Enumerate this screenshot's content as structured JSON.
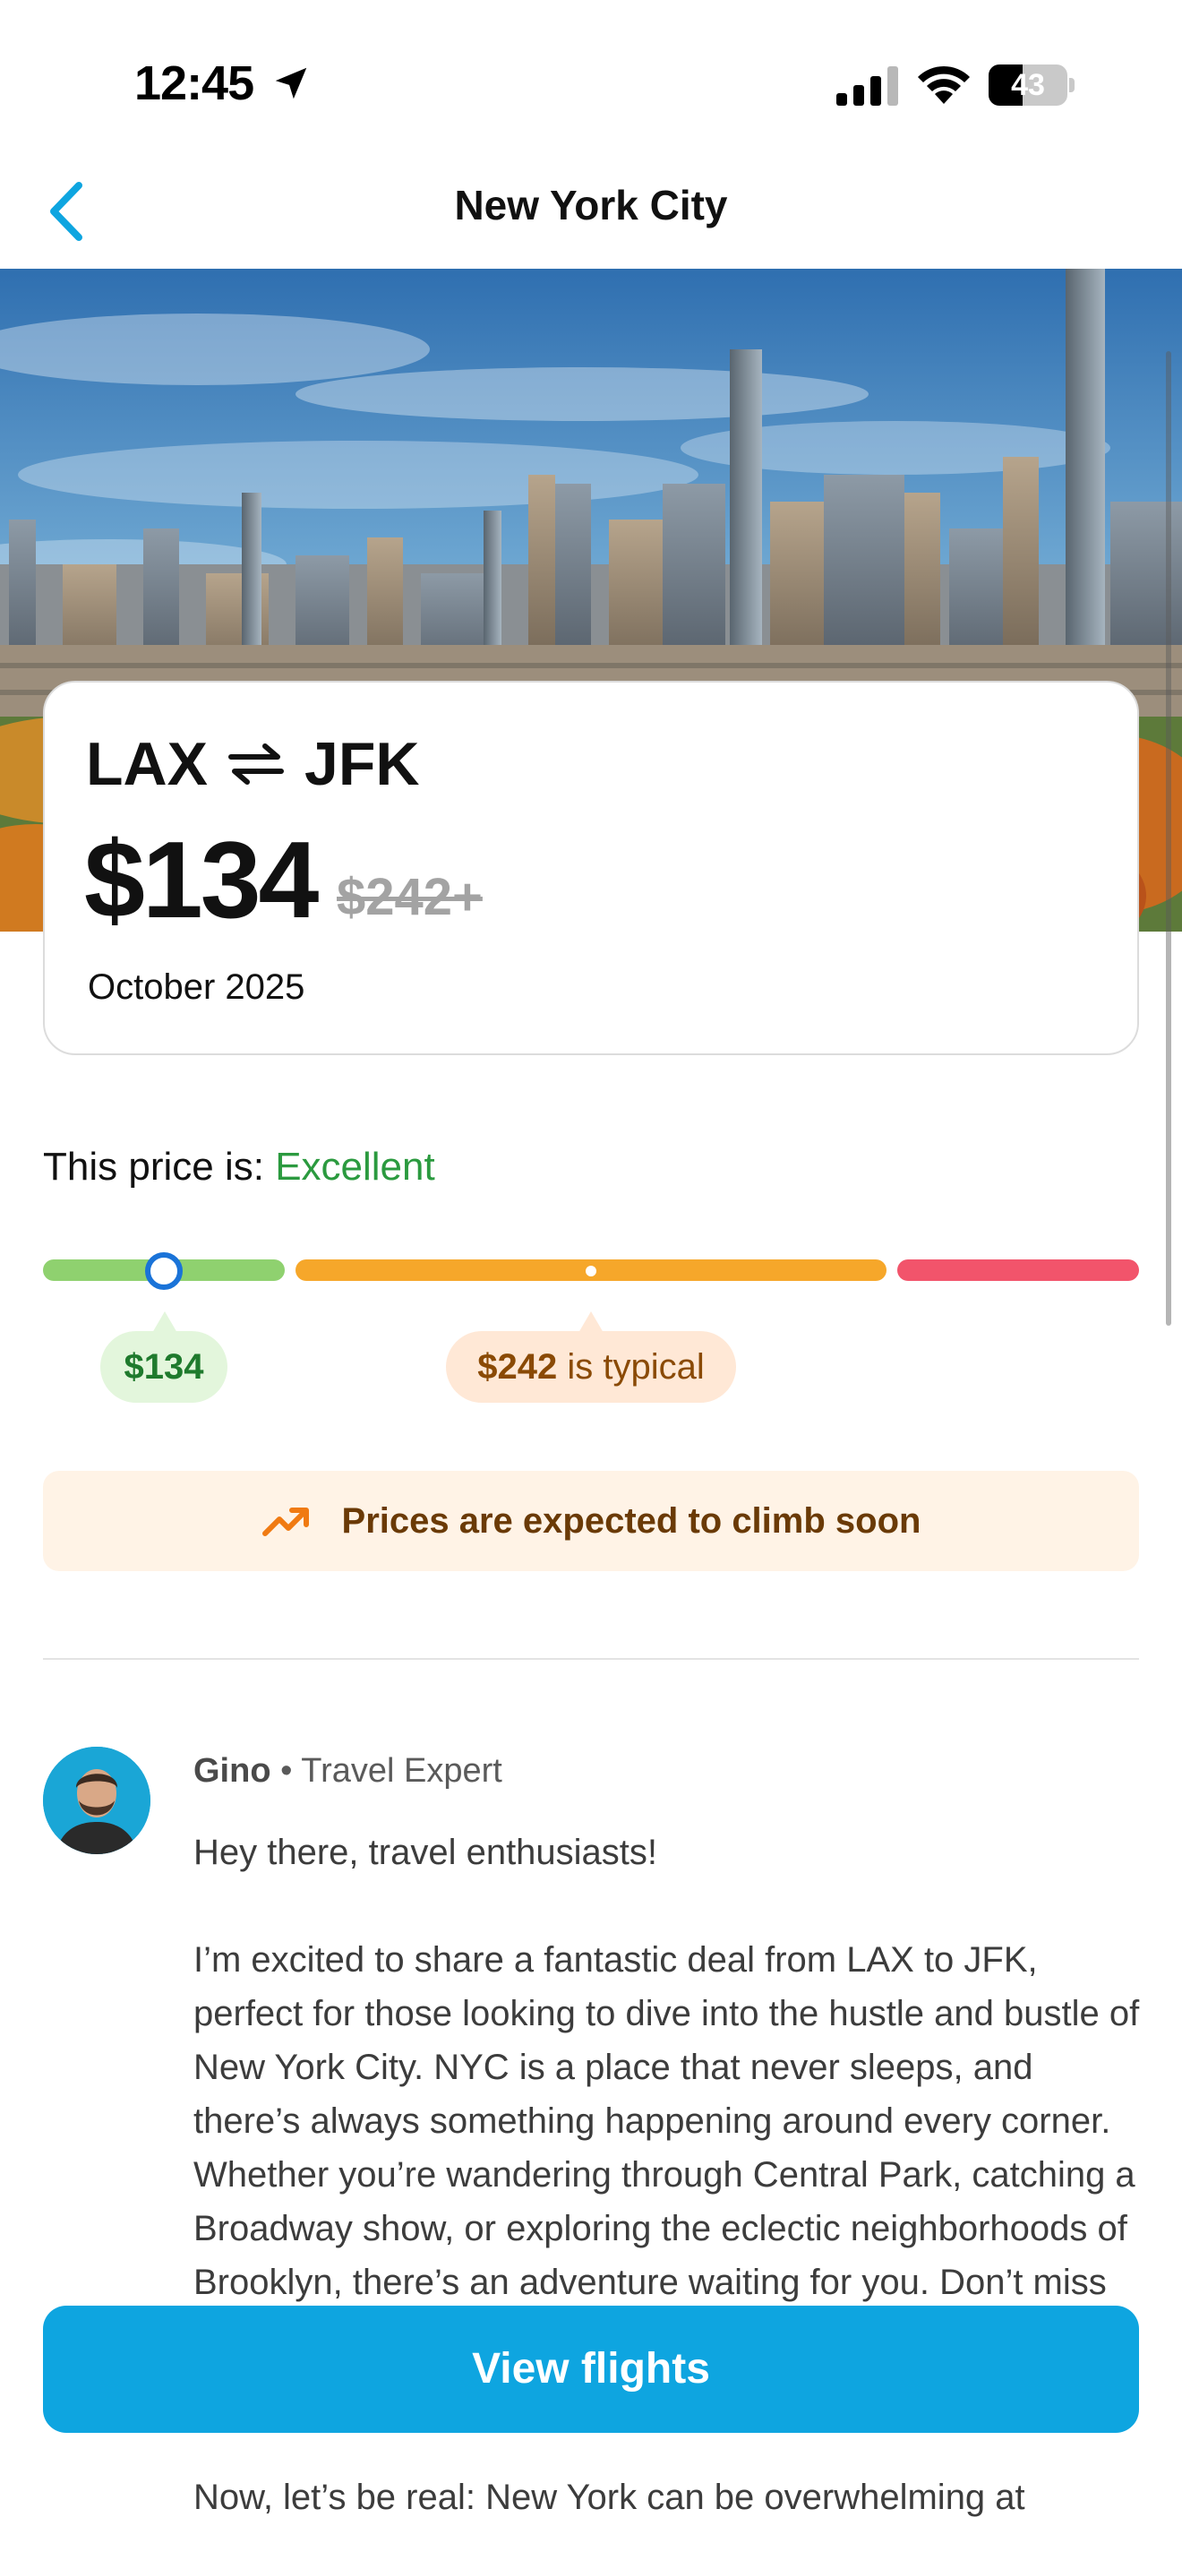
{
  "status_bar": {
    "time": "12:45",
    "battery_percent": "43",
    "battery_level": 0.43
  },
  "nav": {
    "title": "New York City",
    "back_icon": "chevron-left-icon"
  },
  "fare": {
    "origin": "LAX",
    "destination": "JFK",
    "swap_icon": "round-trip-arrows-icon",
    "price": "$134",
    "old_price": "$242+",
    "month": "October 2025"
  },
  "price_rating": {
    "label": "This price is:",
    "verdict": "Excellent",
    "verdict_color": "#2b9a3f",
    "current_pill": "$134",
    "typical_price": "$242",
    "typical_suffix": " is typical",
    "segment_colors": [
      "#8fd16f",
      "#f6a72a",
      "#f2546b"
    ]
  },
  "trend": {
    "icon": "trending-up-icon",
    "text": "Prices are expected to climb soon"
  },
  "post": {
    "author_name": "Gino",
    "separator": " • ",
    "author_role": "Travel Expert",
    "paragraphs": [
      "Hey there, travel enthusiasts!",
      "I’m excited to share a fantastic deal from LAX to JFK, perfect for those looking to dive into the hustle and bustle of New York City. NYC is a place that never sleeps, and there’s always something happening around every corner. Whether you’re wandering through Central Park, catching a Broadway show, or exploring the eclectic neighborhoods of Brooklyn, there’s an adventure waiting for you. Don’t miss out on grabbing a slice of pizza or exploring the diverse culinary offerings in Queens.",
      "Now, let’s be real: New York can be overwhelming at"
    ]
  },
  "cta": {
    "label": "View flights",
    "color": "#0ea5e0"
  }
}
